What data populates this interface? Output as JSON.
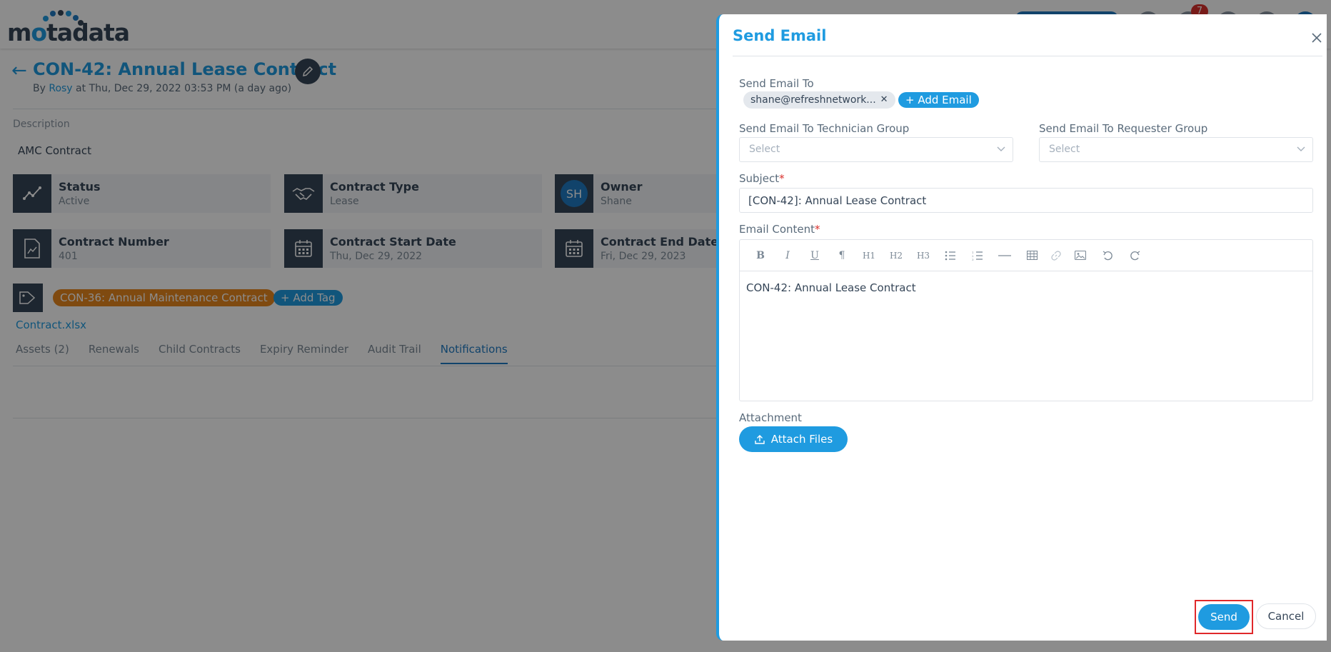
{
  "app": {
    "logo_text": "motadata",
    "notification_count": "7"
  },
  "page": {
    "title": "CON-42: Annual Lease Contract",
    "by_prefix": "By",
    "by_user": "Rosy",
    "by_suffix": "at Thu, Dec 29, 2022 03:53 PM (a day ago)",
    "description_label": "Description",
    "description_value": "AMC Contract",
    "cards": [
      {
        "label": "Status",
        "value": "Active",
        "icon": "trend-icon"
      },
      {
        "label": "Contract Type",
        "value": "Lease",
        "icon": "handshake-icon"
      },
      {
        "label": "Owner",
        "value": "Shane",
        "avatar": "SH"
      },
      {
        "label": "Contract Number",
        "value": "401",
        "icon": "document-chart-icon"
      },
      {
        "label": "Contract Start Date",
        "value": "Thu, Dec 29, 2022",
        "icon": "calendar-icon"
      },
      {
        "label": "Contract End Date",
        "value": "Fri, Dec 29, 2023",
        "icon": "calendar-icon"
      }
    ],
    "tag": "CON-36: Annual Maintenance Contract",
    "add_tag": "+ Add Tag",
    "file": "Contract.xlsx",
    "tabs": [
      "Assets (2)",
      "Renewals",
      "Child Contracts",
      "Expiry Reminder",
      "Audit Trail",
      "Notifications"
    ]
  },
  "drawer": {
    "title": "Send Email",
    "send_to_label": "Send Email To",
    "email_chip": "shane@refreshnetwork...",
    "add_email": "Add Email",
    "tech_group_label": "Send Email To Technician Group",
    "tech_group_placeholder": "Select",
    "req_group_label": "Send Email To Requester Group",
    "req_group_placeholder": "Select",
    "subject_label": "Subject",
    "subject_value": "[CON-42]: Annual Lease Contract",
    "content_label": "Email Content",
    "content_value": "CON-42: Annual Lease Contract",
    "attachment_label": "Attachment",
    "attach_button": "Attach Files",
    "send_button": "Send",
    "cancel_button": "Cancel",
    "toolbar": {
      "bold": "B",
      "italic": "I",
      "underline": "U",
      "paragraph": "¶",
      "h1": "H1",
      "h2": "H2",
      "h3": "H3"
    }
  },
  "colors": {
    "accent": "#1f9be0",
    "dark": "#364658",
    "tag": "#e8871e",
    "highlight": "#e0282a"
  }
}
